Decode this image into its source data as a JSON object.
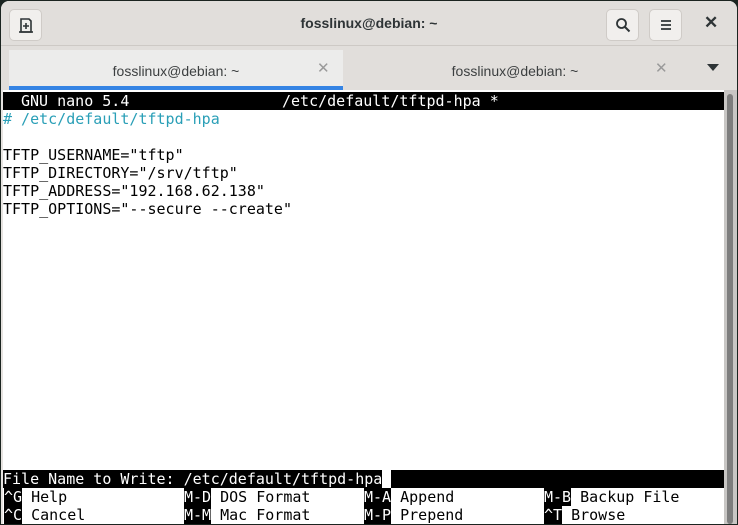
{
  "window": {
    "title": "fosslinux@debian: ~"
  },
  "tabs": [
    {
      "label": "fosslinux@debian: ~",
      "active": true
    },
    {
      "label": "fosslinux@debian: ~",
      "active": false
    }
  ],
  "nano": {
    "version": "GNU nano 5.4",
    "filename": "/etc/default/tftpd-hpa *",
    "lines": [
      "# /etc/default/tftpd-hpa",
      "",
      "TFTP_USERNAME=\"tftp\"",
      "TFTP_DIRECTORY=\"/srv/tftp\"",
      "TFTP_ADDRESS=\"192.168.62.138\"",
      "TFTP_OPTIONS=\"--secure --create\""
    ],
    "prompt": "File Name to Write: /etc/default/tftpd-hpa",
    "shortcuts": [
      {
        "key": "^G",
        "label": "Help"
      },
      {
        "key": "M-D",
        "label": "DOS Format"
      },
      {
        "key": "M-A",
        "label": "Append"
      },
      {
        "key": "M-B",
        "label": "Backup File"
      },
      {
        "key": "^C",
        "label": "Cancel"
      },
      {
        "key": "M-M",
        "label": "Mac Format"
      },
      {
        "key": "M-P",
        "label": "Prepend"
      },
      {
        "key": "^T",
        "label": "Browse"
      }
    ]
  },
  "icons": {
    "new_tab": "new-tab-icon",
    "search": "search-icon",
    "menu": "hamburger-menu-icon",
    "close": "close-icon",
    "tab_menu": "chevron-down-icon"
  },
  "colors": {
    "accent": "#3584e4",
    "comment": "#2a9fb7"
  }
}
